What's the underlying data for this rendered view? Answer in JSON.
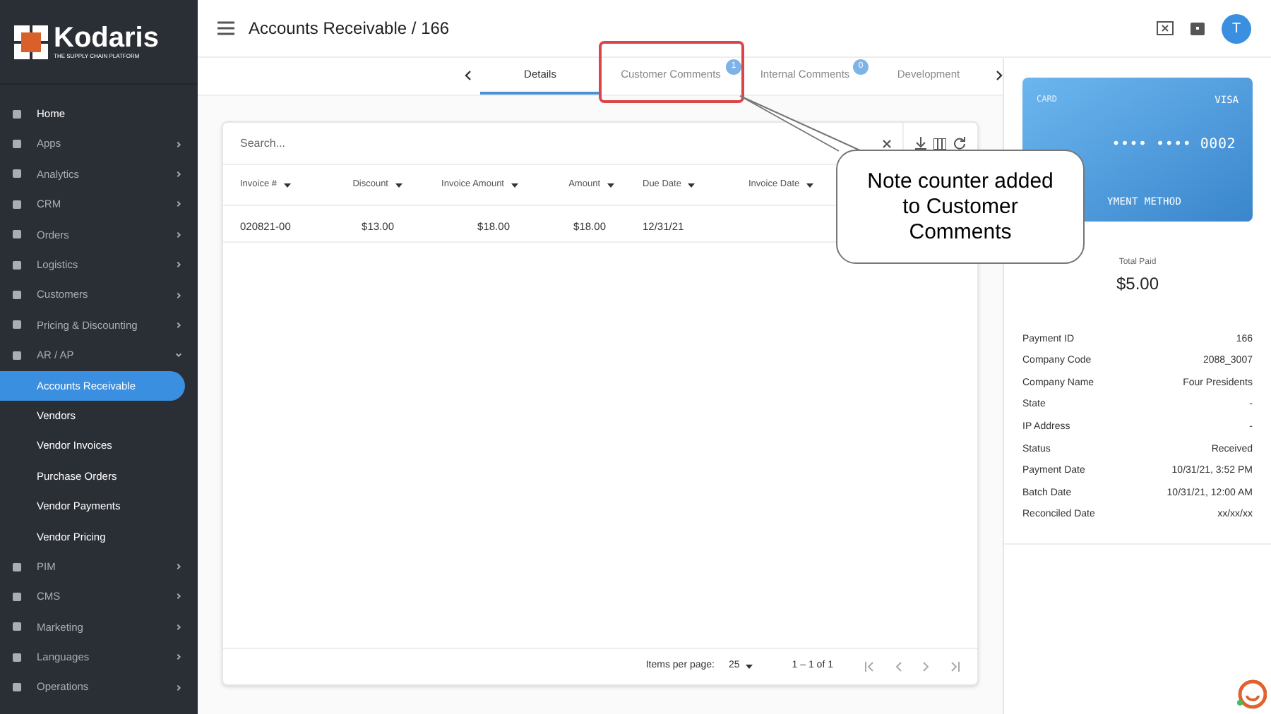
{
  "sidebar": {
    "logo": "Kodaris",
    "tagline": "THE SUPPLY CHAIN PLATFORM",
    "items": [
      {
        "label": "Home",
        "kind": "link"
      },
      {
        "label": "Apps",
        "kind": "group",
        "expanded": false
      },
      {
        "label": "Analytics",
        "kind": "group",
        "expanded": false
      },
      {
        "label": "CRM",
        "kind": "group",
        "expanded": false
      },
      {
        "label": "Orders",
        "kind": "group",
        "expanded": false
      },
      {
        "label": "Logistics",
        "kind": "group",
        "expanded": false
      },
      {
        "label": "Customers",
        "kind": "group",
        "expanded": false
      },
      {
        "label": "Pricing & Discounting",
        "kind": "group",
        "expanded": false
      },
      {
        "label": "AR / AP",
        "kind": "group",
        "expanded": true,
        "children": [
          {
            "label": "Accounts Receivable",
            "selected": true
          },
          {
            "label": "Vendors",
            "selected": false
          },
          {
            "label": "Vendor Invoices",
            "selected": false
          },
          {
            "label": "Purchase Orders",
            "selected": false
          },
          {
            "label": "Vendor Payments",
            "selected": false
          },
          {
            "label": "Vendor Pricing",
            "selected": false
          }
        ]
      },
      {
        "label": "PIM",
        "kind": "group",
        "expanded": false
      },
      {
        "label": "CMS",
        "kind": "group",
        "expanded": false
      },
      {
        "label": "Marketing",
        "kind": "group",
        "expanded": false
      },
      {
        "label": "Languages",
        "kind": "group",
        "expanded": false
      },
      {
        "label": "Operations",
        "kind": "group",
        "expanded": false
      }
    ]
  },
  "header": {
    "title": "Accounts Receivable / 166",
    "avatar": "T"
  },
  "tabs": [
    {
      "label": "Details",
      "selected": true
    },
    {
      "label": "Customer Comments",
      "selected": false,
      "badge": "1"
    },
    {
      "label": "Internal Comments",
      "selected": false,
      "badge": "0"
    },
    {
      "label": "Development",
      "selected": false
    }
  ],
  "table": {
    "search": {
      "placeholder": "Search..."
    },
    "columns": [
      "Invoice #",
      "Discount",
      "Invoice Amount",
      "Amount",
      "Due Date",
      "Invoice Date"
    ],
    "rows": [
      [
        "020821-00",
        "$13.00",
        "$18.00",
        "$18.00",
        "12/31/21",
        ""
      ]
    ],
    "paginator": {
      "label": "Items per page:",
      "page_size": "25",
      "range": "1 – 1 of 1"
    }
  },
  "payment": {
    "card": {
      "type": "CARD",
      "brand": "VISA",
      "number": "•••• •••• 0002",
      "label": "YMENT METHOD"
    },
    "total_label": "Total Paid",
    "total": "$5.00",
    "details": [
      {
        "label": "Payment ID",
        "value": "166"
      },
      {
        "label": "Company Code",
        "value": "2088_3007"
      },
      {
        "label": "Company Name",
        "value": "Four Presidents"
      },
      {
        "label": "State",
        "value": "-"
      },
      {
        "label": "IP Address",
        "value": "-"
      },
      {
        "label": "Status",
        "value": "Received"
      },
      {
        "label": "Payment Date",
        "value": "10/31/21, 3:52 PM"
      },
      {
        "label": "Batch Date",
        "value": "10/31/21, 12:00 AM"
      },
      {
        "label": "Reconciled Date",
        "value": "xx/xx/xx"
      }
    ]
  },
  "callout": {
    "text": "Note counter added to Customer Comments"
  }
}
